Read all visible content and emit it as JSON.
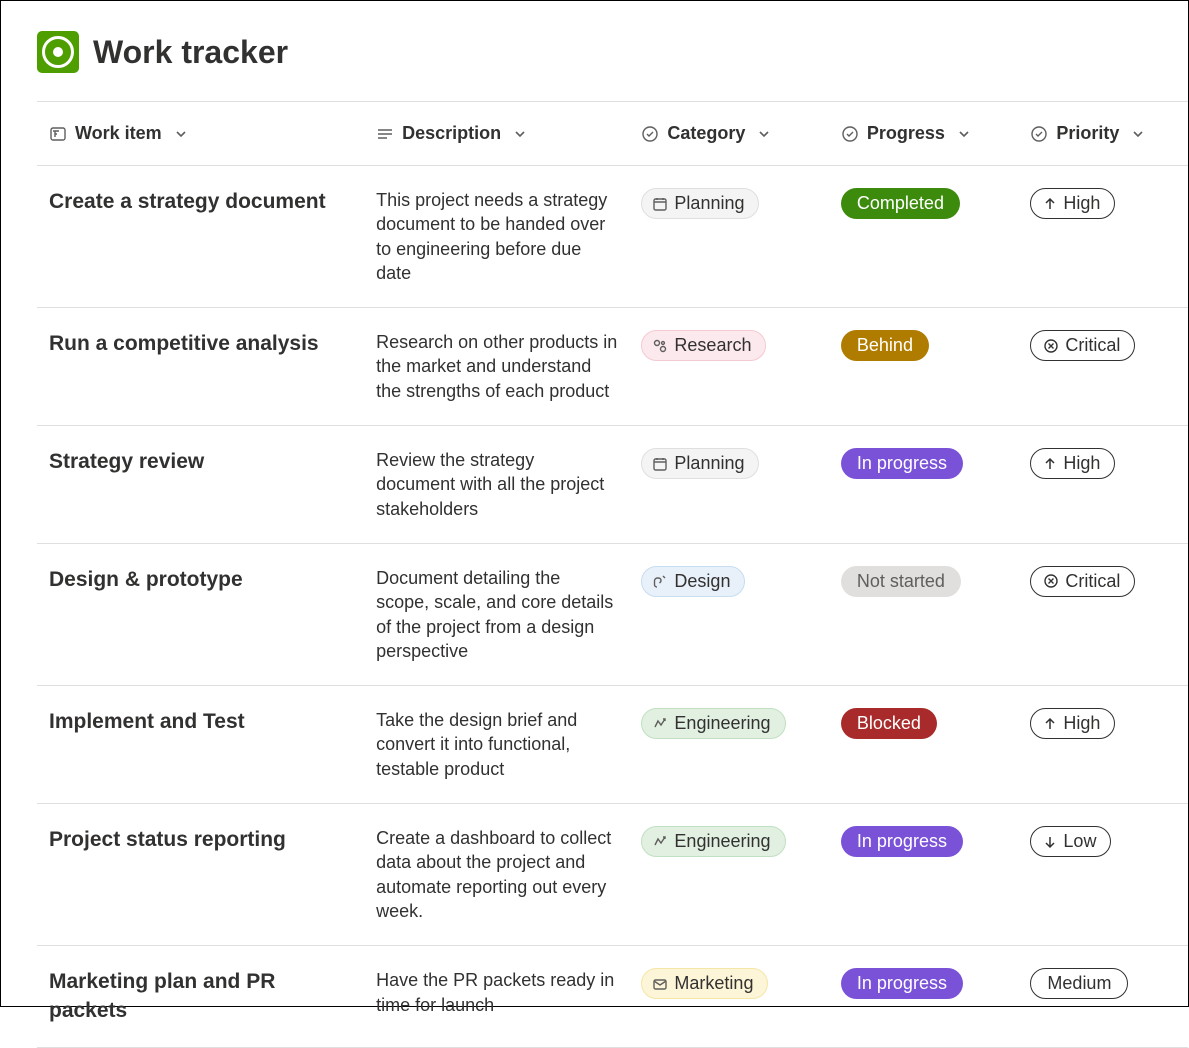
{
  "page_title": "Work tracker",
  "columns": {
    "work_item": "Work item",
    "description": "Description",
    "category": "Category",
    "progress": "Progress",
    "priority": "Priority"
  },
  "rows": [
    {
      "work_item": "Create a strategy document",
      "description": "This project needs a strategy document to be handed over to engineering before due date",
      "category": "Planning",
      "category_type": "planning",
      "progress": "Completed",
      "progress_type": "completed",
      "priority": "High",
      "priority_icon": "up-arrow"
    },
    {
      "work_item": "Run a competitive analysis",
      "description": "Research on other products in the market and understand the strengths of each product",
      "category": "Research",
      "category_type": "research",
      "progress": "Behind",
      "progress_type": "behind",
      "priority": "Critical",
      "priority_icon": "critical"
    },
    {
      "work_item": "Strategy review",
      "description": "Review the strategy document with all the project stakeholders",
      "category": "Planning",
      "category_type": "planning",
      "progress": "In progress",
      "progress_type": "inprogress",
      "priority": "High",
      "priority_icon": "up-arrow"
    },
    {
      "work_item": "Design & prototype",
      "description": "Document detailing the scope, scale, and core details of the project from a design perspective",
      "category": "Design",
      "category_type": "design",
      "progress": "Not started",
      "progress_type": "notstarted",
      "priority": "Critical",
      "priority_icon": "critical"
    },
    {
      "work_item": "Implement and Test",
      "description": "Take the design brief and convert it into functional, testable product",
      "category": "Engineering",
      "category_type": "engineering",
      "progress": "Blocked",
      "progress_type": "blocked",
      "priority": "High",
      "priority_icon": "up-arrow"
    },
    {
      "work_item": "Project status reporting",
      "description": "Create a dashboard to collect data about the project and automate reporting out every week.",
      "category": "Engineering",
      "category_type": "engineering",
      "progress": "In progress",
      "progress_type": "inprogress",
      "priority": "Low",
      "priority_icon": "down-arrow"
    },
    {
      "work_item": "Marketing plan and PR packets",
      "description": "Have the PR packets ready in time for launch",
      "category": "Marketing",
      "category_type": "marketing",
      "progress": "In progress",
      "progress_type": "inprogress",
      "priority": "Medium",
      "priority_icon": "none"
    }
  ]
}
